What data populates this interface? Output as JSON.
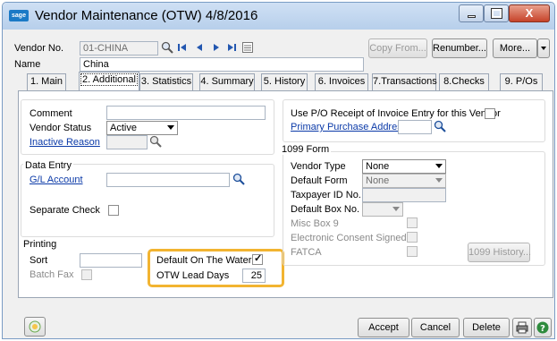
{
  "window": {
    "title": "Vendor Maintenance (OTW) 4/8/2016",
    "app_icon_text": "sage",
    "close_glyph": "X"
  },
  "header": {
    "vendor_no_label": "Vendor No.",
    "vendor_no_value": "01-CHINA",
    "name_label": "Name",
    "name_value": "China",
    "copy_from_label": "Copy From...",
    "renumber_label": "Renumber...",
    "more_label": "More...",
    "nav_icons": [
      "first-record-icon",
      "previous-record-icon",
      "next-record-icon",
      "last-record-icon"
    ]
  },
  "tabs": [
    {
      "label": "1. Main"
    },
    {
      "label": "2. Additional"
    },
    {
      "label": "3. Statistics"
    },
    {
      "label": "4. Summary"
    },
    {
      "label": "5. History"
    },
    {
      "label": "6. Invoices"
    },
    {
      "label": "7.Transactions"
    },
    {
      "label": "8.Checks"
    },
    {
      "label": "9. P/Os"
    }
  ],
  "left": {
    "comment_label": "Comment",
    "comment_value": "",
    "vendor_status_label": "Vendor Status",
    "vendor_status_value": "Active",
    "inactive_reason_label": "Inactive Reason",
    "data_entry_title": "Data Entry",
    "gl_account_label": "G/L Account",
    "gl_account_value": "",
    "separate_check_label": "Separate Check",
    "printing_title": "Printing",
    "sort_label": "Sort",
    "sort_value": "",
    "batch_fax_label": "Batch Fax",
    "default_on_water_label": "Default On The Water",
    "default_on_water_checked": true,
    "otw_lead_days_label": "OTW Lead Days",
    "otw_lead_days_value": "25"
  },
  "right": {
    "use_po_receipt_label": "Use P/O Receipt of Invoice Entry for this Vendor",
    "primary_purchase_address_label": "Primary Purchase Address",
    "form_1099_title": "1099 Form",
    "vendor_type_label": "Vendor Type",
    "vendor_type_value": "None",
    "default_form_label": "Default Form",
    "default_form_value": "None",
    "taxpayer_id_label": "Taxpayer ID No.",
    "default_box_label": "Default Box No.",
    "misc_box9_label": "Misc Box 9",
    "electronic_consent_label": "Electronic Consent Signed",
    "fatca_label": "FATCA",
    "history_1099_label": "1099 History..."
  },
  "footer": {
    "accept_label": "Accept",
    "cancel_label": "Cancel",
    "delete_label": "Delete"
  },
  "colors": {
    "highlight": "#f2b431",
    "link": "#0b3aa8",
    "nav": "#2357b0"
  }
}
